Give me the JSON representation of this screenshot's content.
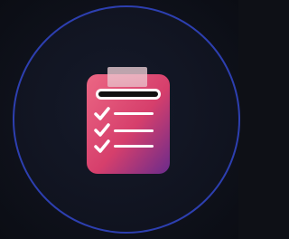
{
  "icon": {
    "name": "clipboard-checklist-icon",
    "checklist_items": 3,
    "colors": {
      "body_top": "#e85a7a",
      "body_bottom": "#a62b5e",
      "accent_bottom_right": "#5a2a8a",
      "clip": "#e9c4cc",
      "header_bar": "#111111",
      "check_and_lines": "#ffffff"
    }
  },
  "frame": {
    "ring_color": "#2d3fb0",
    "background_color": "#0e1016"
  }
}
